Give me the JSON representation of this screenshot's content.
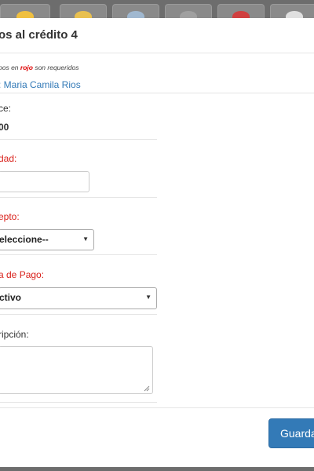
{
  "window": {
    "thumbnail_colors": [
      "#f0c040",
      "#e8c050",
      "#a0b8d0",
      "#a0a0a0",
      "#d04040",
      "#e0e0e0"
    ]
  },
  "modal": {
    "title": "os al crédito 4",
    "required_note_prefix": "pos en ",
    "required_note_red": "rojo",
    "required_note_suffix": " son requeridos",
    "client_text": ": Maria Camila Rios"
  },
  "form": {
    "balance_label": "ce:",
    "balance_value": "00",
    "quantity_label": "dad:",
    "quantity_value": "",
    "concept_label": "epto:",
    "concept_selected": "eleccione--",
    "payment_label": "a de Pago:",
    "payment_selected": "ctivo",
    "description_label": "ripción:",
    "description_value": ""
  },
  "footer": {
    "save_label": "Guardar"
  }
}
